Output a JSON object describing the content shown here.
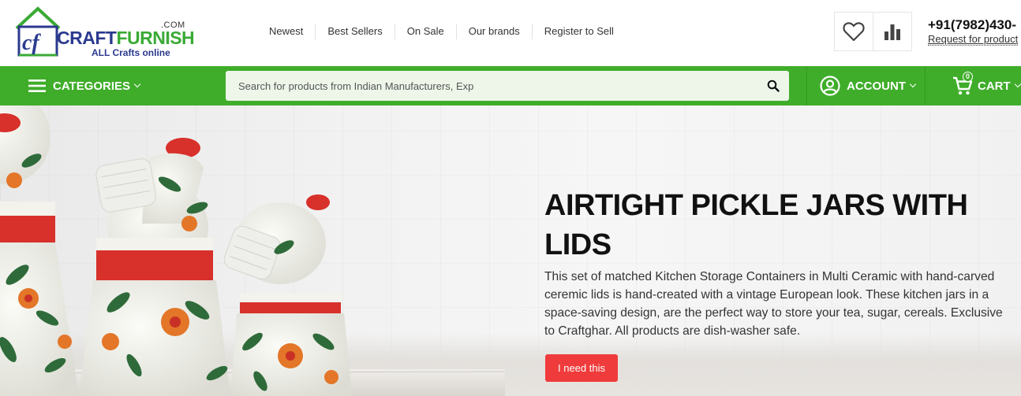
{
  "logo": {
    "com": ".COM",
    "name_part1": "CRAFT",
    "name_part2": "FURNISH",
    "tagline": "ALL Crafts online",
    "mark": "cf"
  },
  "top_nav": [
    "Newest",
    "Best Sellers",
    "On Sale",
    "Our brands",
    "Register to Sell"
  ],
  "header_icons": {
    "wishlist": "heart-icon",
    "compare": "bar-chart-icon"
  },
  "contact": {
    "phone": "+91(7982)430-",
    "request_link": "Request for product"
  },
  "nav_bar": {
    "categories_label": "CATEGORIES",
    "search_placeholder": "Search for products from Indian Manufacturers, Exp",
    "account_label": "ACCOUNT",
    "cart_label": "CART",
    "cart_count": "0"
  },
  "hero": {
    "title": "AIRTIGHT PICKLE JARS WITH LIDS",
    "description": "This set of matched Kitchen Storage Containers in Multi Ceramic with hand-carved ceremic lids is hand-created with a vintage European look. These kitchen jars in a space-saving design, are the perfect way to store your tea, sugar, cereals. Exclusive to Craftghar. All products are dish-washer safe.",
    "button_label": "I need this"
  },
  "colors": {
    "brand_green": "#3fad2a",
    "brand_blue": "#2b3a8f",
    "cta_red": "#ef3b3b",
    "jar_red": "#d8302a"
  }
}
